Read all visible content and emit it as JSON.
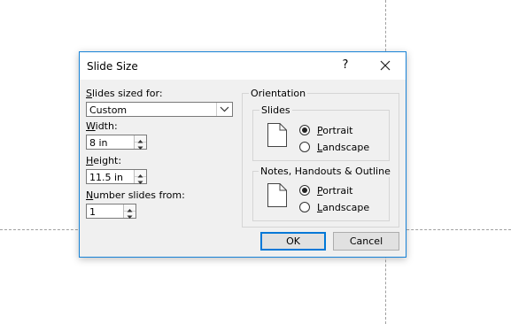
{
  "dialog": {
    "title": "Slide Size",
    "help_glyph": "?",
    "close_icon": "close-icon"
  },
  "left": {
    "slides_sized_for": {
      "label_ul": "S",
      "label_rest": "lides sized for:",
      "value": "Custom"
    },
    "width": {
      "label_ul": "W",
      "label_rest": "idth:",
      "value": "8 in"
    },
    "height": {
      "label_ul": "H",
      "label_rest": "eight:",
      "value": "11.5 in"
    },
    "number_from": {
      "label_ul": "N",
      "label_rest": "umber slides from:",
      "value": "1"
    }
  },
  "orientation": {
    "title": "Orientation",
    "slides": {
      "title": "Slides",
      "portrait": {
        "ul": "P",
        "rest": "ortrait",
        "checked": true
      },
      "landscape": {
        "ul": "L",
        "rest": "andscape",
        "checked": false
      }
    },
    "notes": {
      "title": "Notes, Handouts & Outline",
      "portrait": {
        "ul": "P",
        "rest": "ortrait",
        "checked": true
      },
      "landscape": {
        "ul": "L",
        "rest": "andscape",
        "checked": false
      }
    }
  },
  "buttons": {
    "ok": "OK",
    "cancel": "Cancel"
  },
  "colors": {
    "accent": "#1883d7",
    "dialog_bg": "#f0f0f0"
  }
}
